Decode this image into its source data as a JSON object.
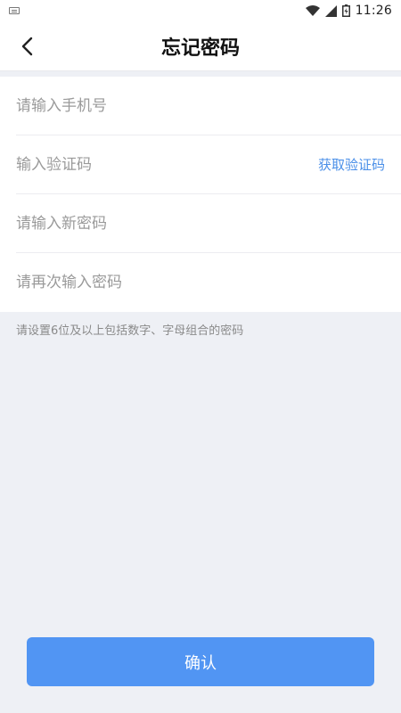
{
  "status_bar": {
    "time": "11:26",
    "icons": [
      "keyboard-icon",
      "wifi-icon",
      "signal-icon",
      "battery-icon"
    ]
  },
  "header": {
    "title": "忘记密码",
    "back_icon": "chevron-left-icon"
  },
  "form": {
    "phone_placeholder": "请输入手机号",
    "code_placeholder": "输入验证码",
    "get_code_label": "获取验证码",
    "new_password_placeholder": "请输入新密码",
    "confirm_password_placeholder": "请再次输入密码"
  },
  "hint": "请设置6位及以上包括数字、字母组合的密码",
  "confirm_label": "确认",
  "colors": {
    "accent": "#5195f3",
    "link": "#4a8fe8",
    "background": "#eef0f5"
  }
}
